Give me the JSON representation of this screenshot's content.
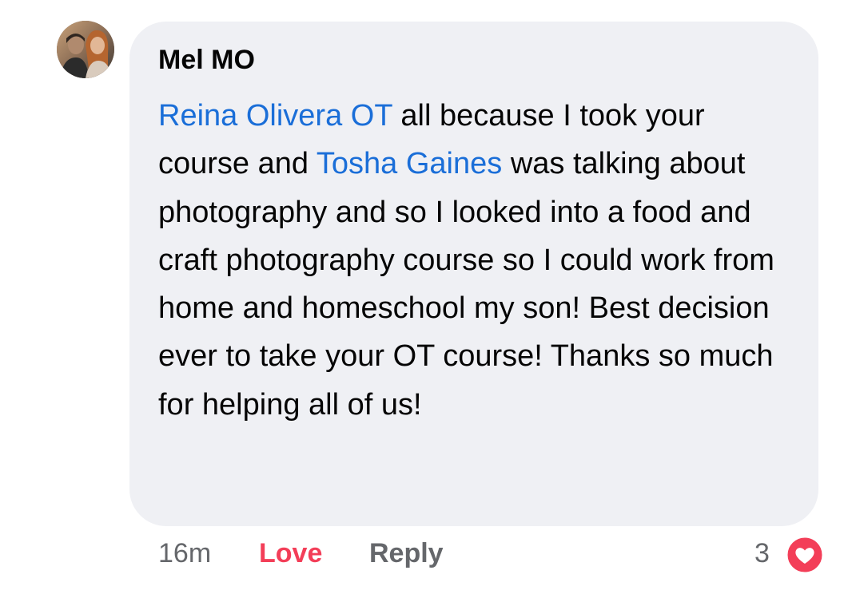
{
  "comment": {
    "author": "Mel MO",
    "mention_1": "Reina Olivera OT",
    "text_1": " all because I took your course and ",
    "mention_2": "Tosha Gaines",
    "text_2": " was talking about photography and so I looked into a food and craft photography course so I could work from home and homeschool my son! Best decision ever to take your OT course! Thanks so much for helping all of us!",
    "timestamp": "16m",
    "love_label": "Love",
    "reply_label": "Reply",
    "reaction_count": "3",
    "reaction_icon": "love-heart-icon"
  },
  "colors": {
    "bubble": "#eff0f4",
    "mention": "#1a6ed8",
    "love": "#f33e58",
    "muted": "#65676b"
  }
}
